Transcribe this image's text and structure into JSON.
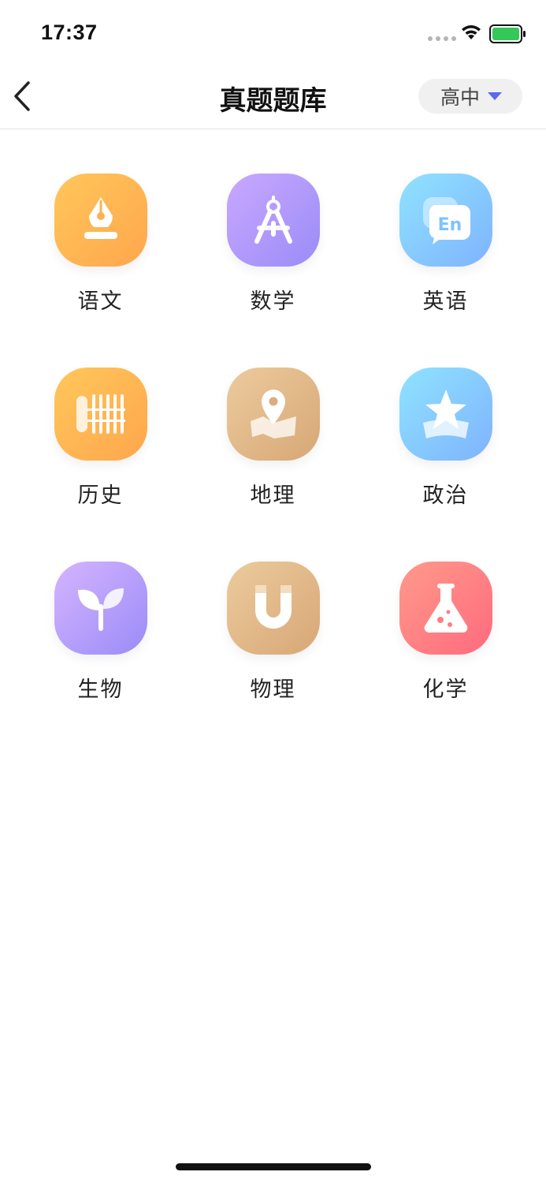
{
  "status_bar": {
    "time": "17:37"
  },
  "nav": {
    "title": "真题题库",
    "level": "高中"
  },
  "subjects": [
    {
      "label": "语文",
      "icon": "pen-nib-icon",
      "color_from": "#ffc75a",
      "color_to": "#ffa64d"
    },
    {
      "label": "数学",
      "icon": "compass-icon",
      "color_from": "#c9a8ff",
      "color_to": "#9a8cf7"
    },
    {
      "label": "英语",
      "icon": "english-bubble-icon",
      "color_from": "#8fe3ff",
      "color_to": "#7fb3ff"
    },
    {
      "label": "历史",
      "icon": "scroll-icon",
      "color_from": "#ffc75a",
      "color_to": "#ffa64d"
    },
    {
      "label": "地理",
      "icon": "map-pin-icon",
      "color_from": "#eccb9d",
      "color_to": "#d7a776"
    },
    {
      "label": "政治",
      "icon": "star-icon",
      "color_from": "#8fe3ff",
      "color_to": "#7fb3ff"
    },
    {
      "label": "生物",
      "icon": "sprout-icon",
      "color_from": "#d5b4ff",
      "color_to": "#9a8cf7"
    },
    {
      "label": "物理",
      "icon": "magnet-icon",
      "color_from": "#eccb9d",
      "color_to": "#d7a776"
    },
    {
      "label": "化学",
      "icon": "flask-icon",
      "color_from": "#ff9a8a",
      "color_to": "#ff6a7e"
    }
  ]
}
